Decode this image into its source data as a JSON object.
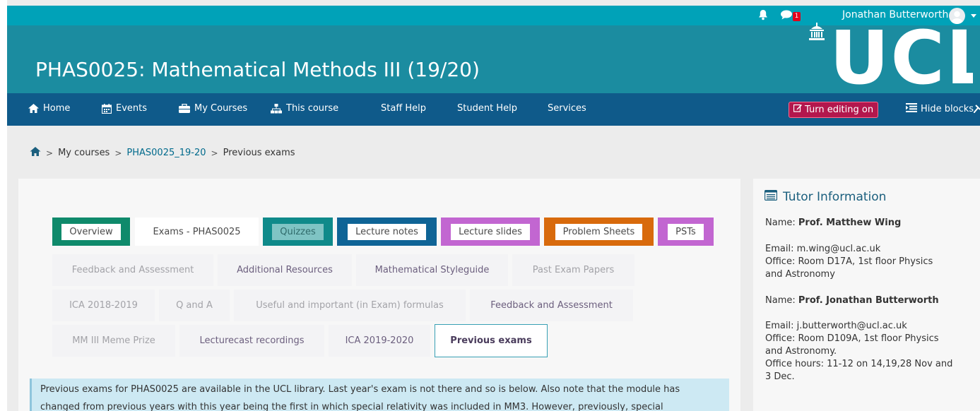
{
  "topbar": {
    "notifications_icon": "bell-icon",
    "messages_icon": "chat-icon",
    "messages_badge": "1",
    "username": "Jonathan Butterworth",
    "user_menu_icon": "caret-down-icon"
  },
  "header": {
    "course_title": "PHAS0025: Mathematical Methods III (19/20)",
    "logo_text": "UCL"
  },
  "nav": {
    "items": [
      {
        "label": "Home",
        "icon": "home-icon"
      },
      {
        "label": "Events",
        "icon": "calendar-icon"
      },
      {
        "label": "My Courses",
        "icon": "briefcase-icon"
      },
      {
        "label": "This course",
        "icon": "sitemap-icon"
      },
      {
        "label": "Staff Help"
      },
      {
        "label": "Student Help"
      },
      {
        "label": "Services"
      }
    ],
    "edit_button": "Turn editing on",
    "hide_blocks": "Hide blocks"
  },
  "breadcrumb": {
    "home_icon": "home-icon",
    "items": [
      "My courses",
      "PHAS0025_19-20",
      "Previous exams"
    ],
    "separator": ">"
  },
  "tabs": {
    "row1": [
      "Overview",
      "Exams - PHAS0025",
      "Quizzes",
      "Lecture notes",
      "Lecture slides",
      "Problem Sheets",
      "PSTs"
    ],
    "row2": [
      "Feedback and Assessment",
      "Additional Resources",
      "Mathematical Styleguide",
      "Past Exam Papers"
    ],
    "row3": [
      "ICA 2018-2019",
      "Q and A",
      "Useful and important (in Exam) formulas",
      "Feedback and Assessment"
    ],
    "row4": [
      "MM III Meme Prize",
      "Lecturecast recordings",
      "ICA 2019-2020",
      "Previous exams"
    ],
    "active": "Previous exams",
    "colors": {
      "overview": "#0f8a6b",
      "quizzes": "#0f8a8a",
      "lecture_notes": "#0f6496",
      "lecture_slides": "#c266d1",
      "problem_sheets": "#d86a0c",
      "psts": "#c266d1"
    }
  },
  "notice": {
    "line1": "Previous exams for PHAS0025 are available in the UCL library.  Last year's exam is not there and so is below.  Also note that the module has",
    "line2": "changed from previous years with this year being the first in which special relativity was included in MM3.  However, previously, special"
  },
  "sidebar": {
    "title": "Tutor Information",
    "title_icon": "list-icon",
    "tutor1": {
      "name_label": "Name:",
      "name": "Prof. Matthew Wing",
      "email": "Email: m.wing@ucl.ac.uk",
      "office_line1": "Office: Room D17A, 1st floor Physics",
      "office_line2": "and Astronomy"
    },
    "tutor2": {
      "name_label": "Name:",
      "name": "Prof. Jonathan Butterworth",
      "email": "Email: j.butterworth@ucl.ac.uk",
      "office_line1": "Office: Room D109A, 1st floor Physics",
      "office_line2": "and Astronomy.",
      "hours_line1": "Office hours: 11-12 on 14,19,28 Nov and",
      "hours_line2": "3 Dec."
    }
  },
  "colors": {
    "topbar": "#00a2b8",
    "banner": "#1b8ca0",
    "navbar": "#0f5a8a",
    "edit_button": "#b3174d",
    "notice_bg": "#cde9f3"
  }
}
